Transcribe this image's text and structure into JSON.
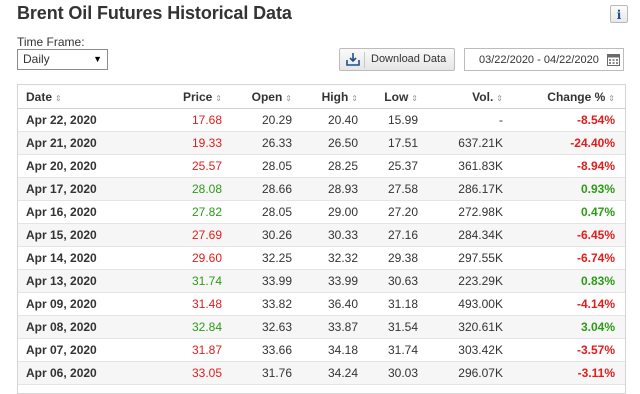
{
  "header": {
    "title": "Brent Oil Futures Historical Data",
    "info_icon": "info-icon"
  },
  "timeframe": {
    "label": "Time Frame:",
    "value": "Daily"
  },
  "download": {
    "label": "Download Data",
    "icon": "download-icon"
  },
  "date_range": {
    "value": "03/22/2020 - 04/22/2020",
    "icon": "calendar-icon"
  },
  "colors": {
    "up": "#2c9b16",
    "down": "#e31c1c"
  },
  "table": {
    "columns": [
      "Date",
      "Price",
      "Open",
      "High",
      "Low",
      "Vol.",
      "Change %"
    ],
    "rows": [
      {
        "date": "Apr 22, 2020",
        "price": "17.68",
        "open": "20.29",
        "high": "20.40",
        "low": "15.99",
        "vol": "-",
        "change": "-8.54%",
        "dir": "down"
      },
      {
        "date": "Apr 21, 2020",
        "price": "19.33",
        "open": "26.33",
        "high": "26.50",
        "low": "17.51",
        "vol": "637.21K",
        "change": "-24.40%",
        "dir": "down"
      },
      {
        "date": "Apr 20, 2020",
        "price": "25.57",
        "open": "28.05",
        "high": "28.25",
        "low": "25.37",
        "vol": "361.83K",
        "change": "-8.94%",
        "dir": "down"
      },
      {
        "date": "Apr 17, 2020",
        "price": "28.08",
        "open": "28.66",
        "high": "28.93",
        "low": "27.58",
        "vol": "286.17K",
        "change": "0.93%",
        "dir": "up"
      },
      {
        "date": "Apr 16, 2020",
        "price": "27.82",
        "open": "28.05",
        "high": "29.00",
        "low": "27.20",
        "vol": "272.98K",
        "change": "0.47%",
        "dir": "up"
      },
      {
        "date": "Apr 15, 2020",
        "price": "27.69",
        "open": "30.26",
        "high": "30.33",
        "low": "27.16",
        "vol": "284.34K",
        "change": "-6.45%",
        "dir": "down"
      },
      {
        "date": "Apr 14, 2020",
        "price": "29.60",
        "open": "32.25",
        "high": "32.32",
        "low": "29.38",
        "vol": "297.55K",
        "change": "-6.74%",
        "dir": "down"
      },
      {
        "date": "Apr 13, 2020",
        "price": "31.74",
        "open": "33.99",
        "high": "33.99",
        "low": "30.63",
        "vol": "223.29K",
        "change": "0.83%",
        "dir": "up"
      },
      {
        "date": "Apr 09, 2020",
        "price": "31.48",
        "open": "33.82",
        "high": "36.40",
        "low": "31.18",
        "vol": "493.00K",
        "change": "-4.14%",
        "dir": "down"
      },
      {
        "date": "Apr 08, 2020",
        "price": "32.84",
        "open": "32.63",
        "high": "33.87",
        "low": "31.54",
        "vol": "320.61K",
        "change": "3.04%",
        "dir": "up"
      },
      {
        "date": "Apr 07, 2020",
        "price": "31.87",
        "open": "33.66",
        "high": "34.18",
        "low": "31.74",
        "vol": "303.42K",
        "change": "-3.57%",
        "dir": "down"
      },
      {
        "date": "Apr 06, 2020",
        "price": "33.05",
        "open": "31.76",
        "high": "34.24",
        "low": "30.03",
        "vol": "296.07K",
        "change": "-3.11%",
        "dir": "down"
      }
    ]
  }
}
